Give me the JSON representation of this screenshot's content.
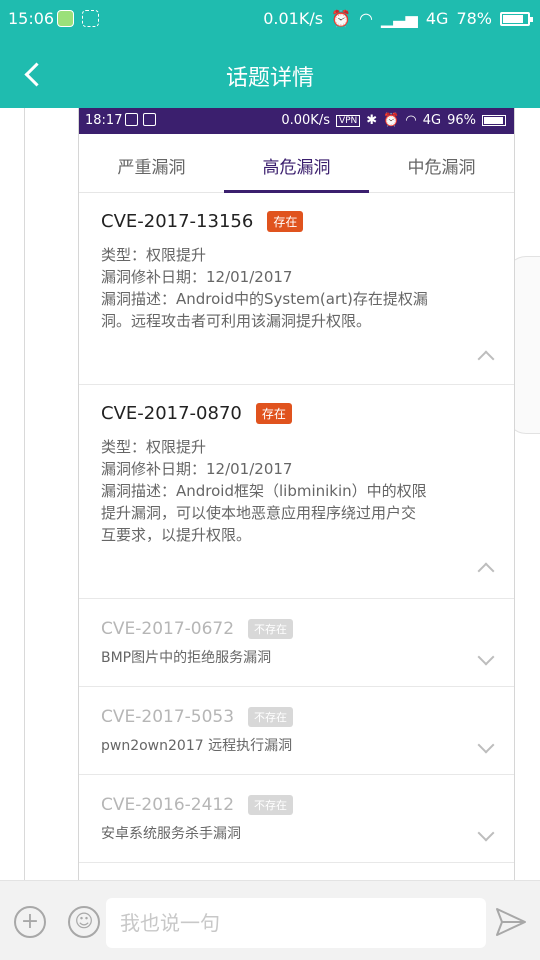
{
  "status_bar": {
    "time": "15:06",
    "speed": "0.01K/s",
    "network": "4G",
    "battery": "78%"
  },
  "header": {
    "title": "话题详情"
  },
  "inner_status": {
    "time": "18:17",
    "speed": "0.00K/s",
    "network": "4G",
    "battery": "96%",
    "vpn": "VPN"
  },
  "tabs": [
    {
      "label": "严重漏洞",
      "active": false
    },
    {
      "label": "高危漏洞",
      "active": true
    },
    {
      "label": "中危漏洞",
      "active": false
    }
  ],
  "items": [
    {
      "id": "CVE-2017-13156",
      "status": "存在",
      "type": "类型：权限提升",
      "date": "漏洞修补日期：12/01/2017",
      "desc": [
        "漏洞描述：Android中的System(art)存在提权漏",
        "洞。远程攻击者可利用该漏洞提升权限。"
      ]
    },
    {
      "id": "CVE-2017-0870",
      "status": "存在",
      "type": "类型：权限提升",
      "date": "漏洞修补日期：12/01/2017",
      "desc": [
        "漏洞描述：Android框架（libminikin）中的权限",
        "提升漏洞，可以使本地恶意应用程序绕过用户交",
        "互要求，以提升权限。"
      ]
    },
    {
      "id": "CVE-2017-0672",
      "status": "不存在",
      "summary": "BMP图片中的拒绝服务漏洞"
    },
    {
      "id": "CVE-2017-5053",
      "status": "不存在",
      "summary": "pwn2own2017 远程执行漏洞"
    },
    {
      "id": "CVE-2016-2412",
      "status": "不存在",
      "summary": "安卓系统服务杀手漏洞"
    }
  ],
  "input": {
    "placeholder": "我也说一句"
  },
  "colors": {
    "primary": "#1fbcaf",
    "inner_primary": "#3b1f6e",
    "badge_present": "#e0531e",
    "badge_absent": "#d8d8d8"
  },
  "icons": {
    "back": "back-arrow-icon",
    "plus": "plus-icon",
    "emoji": "emoji-icon",
    "send": "send-icon"
  }
}
